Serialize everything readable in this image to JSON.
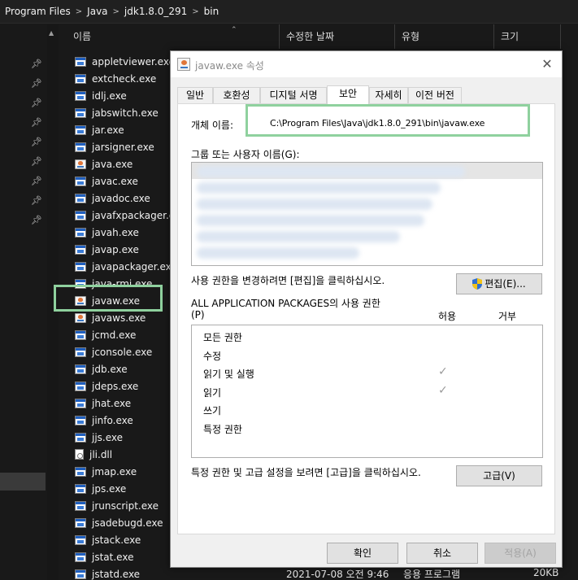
{
  "breadcrumb": [
    "Program Files",
    "Java",
    "jdk1.8.0_291",
    "bin"
  ],
  "columns": {
    "name": "이름",
    "modified": "수정한 날짜",
    "type": "유형",
    "size": "크기"
  },
  "files": [
    {
      "name": "appletviewer.exe",
      "icon": "exe"
    },
    {
      "name": "extcheck.exe",
      "icon": "exe"
    },
    {
      "name": "idlj.exe",
      "icon": "exe"
    },
    {
      "name": "jabswitch.exe",
      "icon": "exe"
    },
    {
      "name": "jar.exe",
      "icon": "exe"
    },
    {
      "name": "jarsigner.exe",
      "icon": "exe"
    },
    {
      "name": "java.exe",
      "icon": "java"
    },
    {
      "name": "javac.exe",
      "icon": "exe"
    },
    {
      "name": "javadoc.exe",
      "icon": "exe"
    },
    {
      "name": "javafxpackager.exe",
      "icon": "exe"
    },
    {
      "name": "javah.exe",
      "icon": "exe"
    },
    {
      "name": "javap.exe",
      "icon": "exe"
    },
    {
      "name": "javapackager.exe",
      "icon": "exe"
    },
    {
      "name": "java-rmi.exe",
      "icon": "exe"
    },
    {
      "name": "javaw.exe",
      "icon": "java"
    },
    {
      "name": "javaws.exe",
      "icon": "java"
    },
    {
      "name": "jcmd.exe",
      "icon": "exe"
    },
    {
      "name": "jconsole.exe",
      "icon": "exe"
    },
    {
      "name": "jdb.exe",
      "icon": "exe"
    },
    {
      "name": "jdeps.exe",
      "icon": "exe"
    },
    {
      "name": "jhat.exe",
      "icon": "exe"
    },
    {
      "name": "jinfo.exe",
      "icon": "exe"
    },
    {
      "name": "jjs.exe",
      "icon": "exe"
    },
    {
      "name": "jli.dll",
      "icon": "dll"
    },
    {
      "name": "jmap.exe",
      "icon": "exe"
    },
    {
      "name": "jps.exe",
      "icon": "exe"
    },
    {
      "name": "jrunscript.exe",
      "icon": "exe"
    },
    {
      "name": "jsadebugd.exe",
      "icon": "exe"
    },
    {
      "name": "jstack.exe",
      "icon": "exe"
    },
    {
      "name": "jstat.exe",
      "icon": "exe"
    },
    {
      "name": "jstatd.exe",
      "icon": "exe"
    }
  ],
  "bottom_row": {
    "modified": "2021-07-08 오전 9:46",
    "type": "응용 프로그램",
    "size": "20KB"
  },
  "dialog": {
    "title": "javaw.exe 속성",
    "tabs": [
      "일반",
      "호환성",
      "디지털 서명",
      "보안",
      "자세히",
      "이전 버전"
    ],
    "active_tab": "보안",
    "object_name_label": "개체 이름:",
    "object_name_value": "C:\\Program Files\\Java\\jdk1.8.0_291\\bin\\javaw.exe",
    "groups_label": "그룹 또는 사용자 이름(G):",
    "change_hint": "사용 권한을 변경하려면 [편집]을 클릭하십시오.",
    "edit_button": "편집(E)...",
    "perm_title_line1": "ALL APPLICATION PACKAGES의 사용 권한",
    "perm_title_line2": "(P)",
    "allow_col": "허용",
    "deny_col": "거부",
    "permissions": [
      {
        "name": "모든 권한",
        "allow": false
      },
      {
        "name": "수정",
        "allow": false
      },
      {
        "name": "읽기 및 실행",
        "allow": true
      },
      {
        "name": "읽기",
        "allow": true
      },
      {
        "name": "쓰기",
        "allow": false
      },
      {
        "name": "특정 권한",
        "allow": false
      }
    ],
    "advanced_hint": "특정 권한 및 고급 설정을 보려면 [고급]을 클릭하십시오.",
    "advanced_button": "고급(V)",
    "ok_button": "확인",
    "cancel_button": "취소",
    "apply_button": "적용(A)"
  },
  "colors": {
    "highlight_green": "#8fd19e",
    "explorer_bg": "#191919",
    "dialog_bg": "#f0f0f0"
  }
}
